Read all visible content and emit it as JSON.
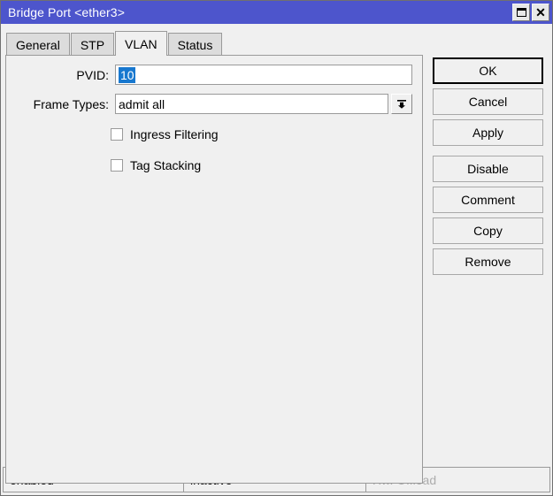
{
  "window": {
    "title": "Bridge Port <ether3>",
    "controls": [
      {
        "name": "restore-button",
        "icon": "restore-icon",
        "label": ""
      },
      {
        "name": "close-button",
        "icon": "close-icon",
        "label": "✕"
      }
    ]
  },
  "tabs": [
    {
      "label": "General",
      "active": false
    },
    {
      "label": "STP",
      "active": false
    },
    {
      "label": "VLAN",
      "active": true
    },
    {
      "label": "Status",
      "active": false
    }
  ],
  "form": {
    "pvid": {
      "label": "PVID:",
      "value": "10",
      "selected": true
    },
    "frame_types": {
      "label": "Frame Types:",
      "value": "admit all",
      "dropdown_icon": "chevron-down-icon"
    },
    "checkboxes": [
      {
        "label": "Ingress Filtering",
        "checked": false
      },
      {
        "label": "Tag Stacking",
        "checked": false
      }
    ]
  },
  "buttons": [
    {
      "label": "OK",
      "name": "ok-button",
      "default": true
    },
    {
      "label": "Cancel",
      "name": "cancel-button",
      "default": false
    },
    {
      "label": "Apply",
      "name": "apply-button",
      "default": false
    },
    {
      "label": "Disable",
      "name": "disable-button",
      "default": false
    },
    {
      "label": "Comment",
      "name": "comment-button",
      "default": false
    },
    {
      "label": "Copy",
      "name": "copy-button",
      "default": false
    },
    {
      "label": "Remove",
      "name": "remove-button",
      "default": false
    }
  ],
  "statusbar": {
    "enabled": "enabled",
    "inactive": "inactive",
    "hw_offload": "Hw. Offload"
  },
  "colors": {
    "titlebar": "#4d55cc",
    "selection": "#1878cf",
    "face": "#f0f0f0",
    "tab_inactive": "#dcdcdc",
    "border": "#9a9a9a",
    "disabled_text": "#adadad"
  }
}
